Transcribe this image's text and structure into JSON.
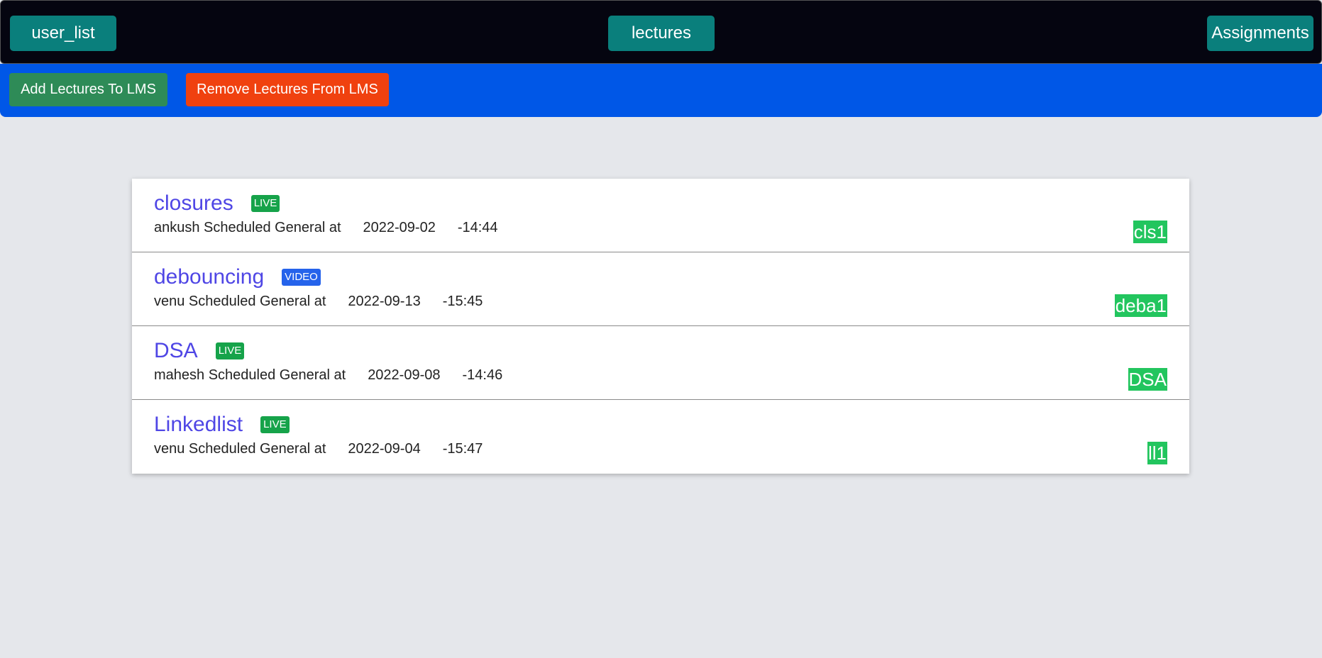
{
  "nav": {
    "user_list": "user_list",
    "lectures": "lectures",
    "assignments": "Assignments"
  },
  "actions": {
    "add": "Add Lectures To LMS",
    "remove": "Remove Lectures From LMS"
  },
  "lectures": [
    {
      "title": "closures",
      "badge": "LIVE",
      "meta": "ankush Scheduled General at",
      "date": "2022-09-02",
      "time": "-14:44",
      "code": "cls1"
    },
    {
      "title": "debouncing",
      "badge": "VIDEO",
      "meta": "venu Scheduled General at",
      "date": "2022-09-13",
      "time": "-15:45",
      "code": "deba1"
    },
    {
      "title": "DSA",
      "badge": "LIVE",
      "meta": "mahesh Scheduled General at",
      "date": "2022-09-08",
      "time": "-14:46",
      "code": "DSA"
    },
    {
      "title": "Linkedlist",
      "badge": "LIVE",
      "meta": "venu Scheduled General at",
      "date": "2022-09-04",
      "time": "-15:47",
      "code": "ll1"
    }
  ],
  "colors": {
    "topbar": "#050510",
    "nav_button": "#0a7f7c",
    "actionbar": "#0057e7",
    "add_button": "#2e8b57",
    "remove_button": "#f0410f",
    "title": "#4f46e5",
    "live_badge": "#16a34a",
    "video_badge": "#2563eb",
    "code_tag": "#22c55e",
    "background": "#e5e7eb"
  }
}
